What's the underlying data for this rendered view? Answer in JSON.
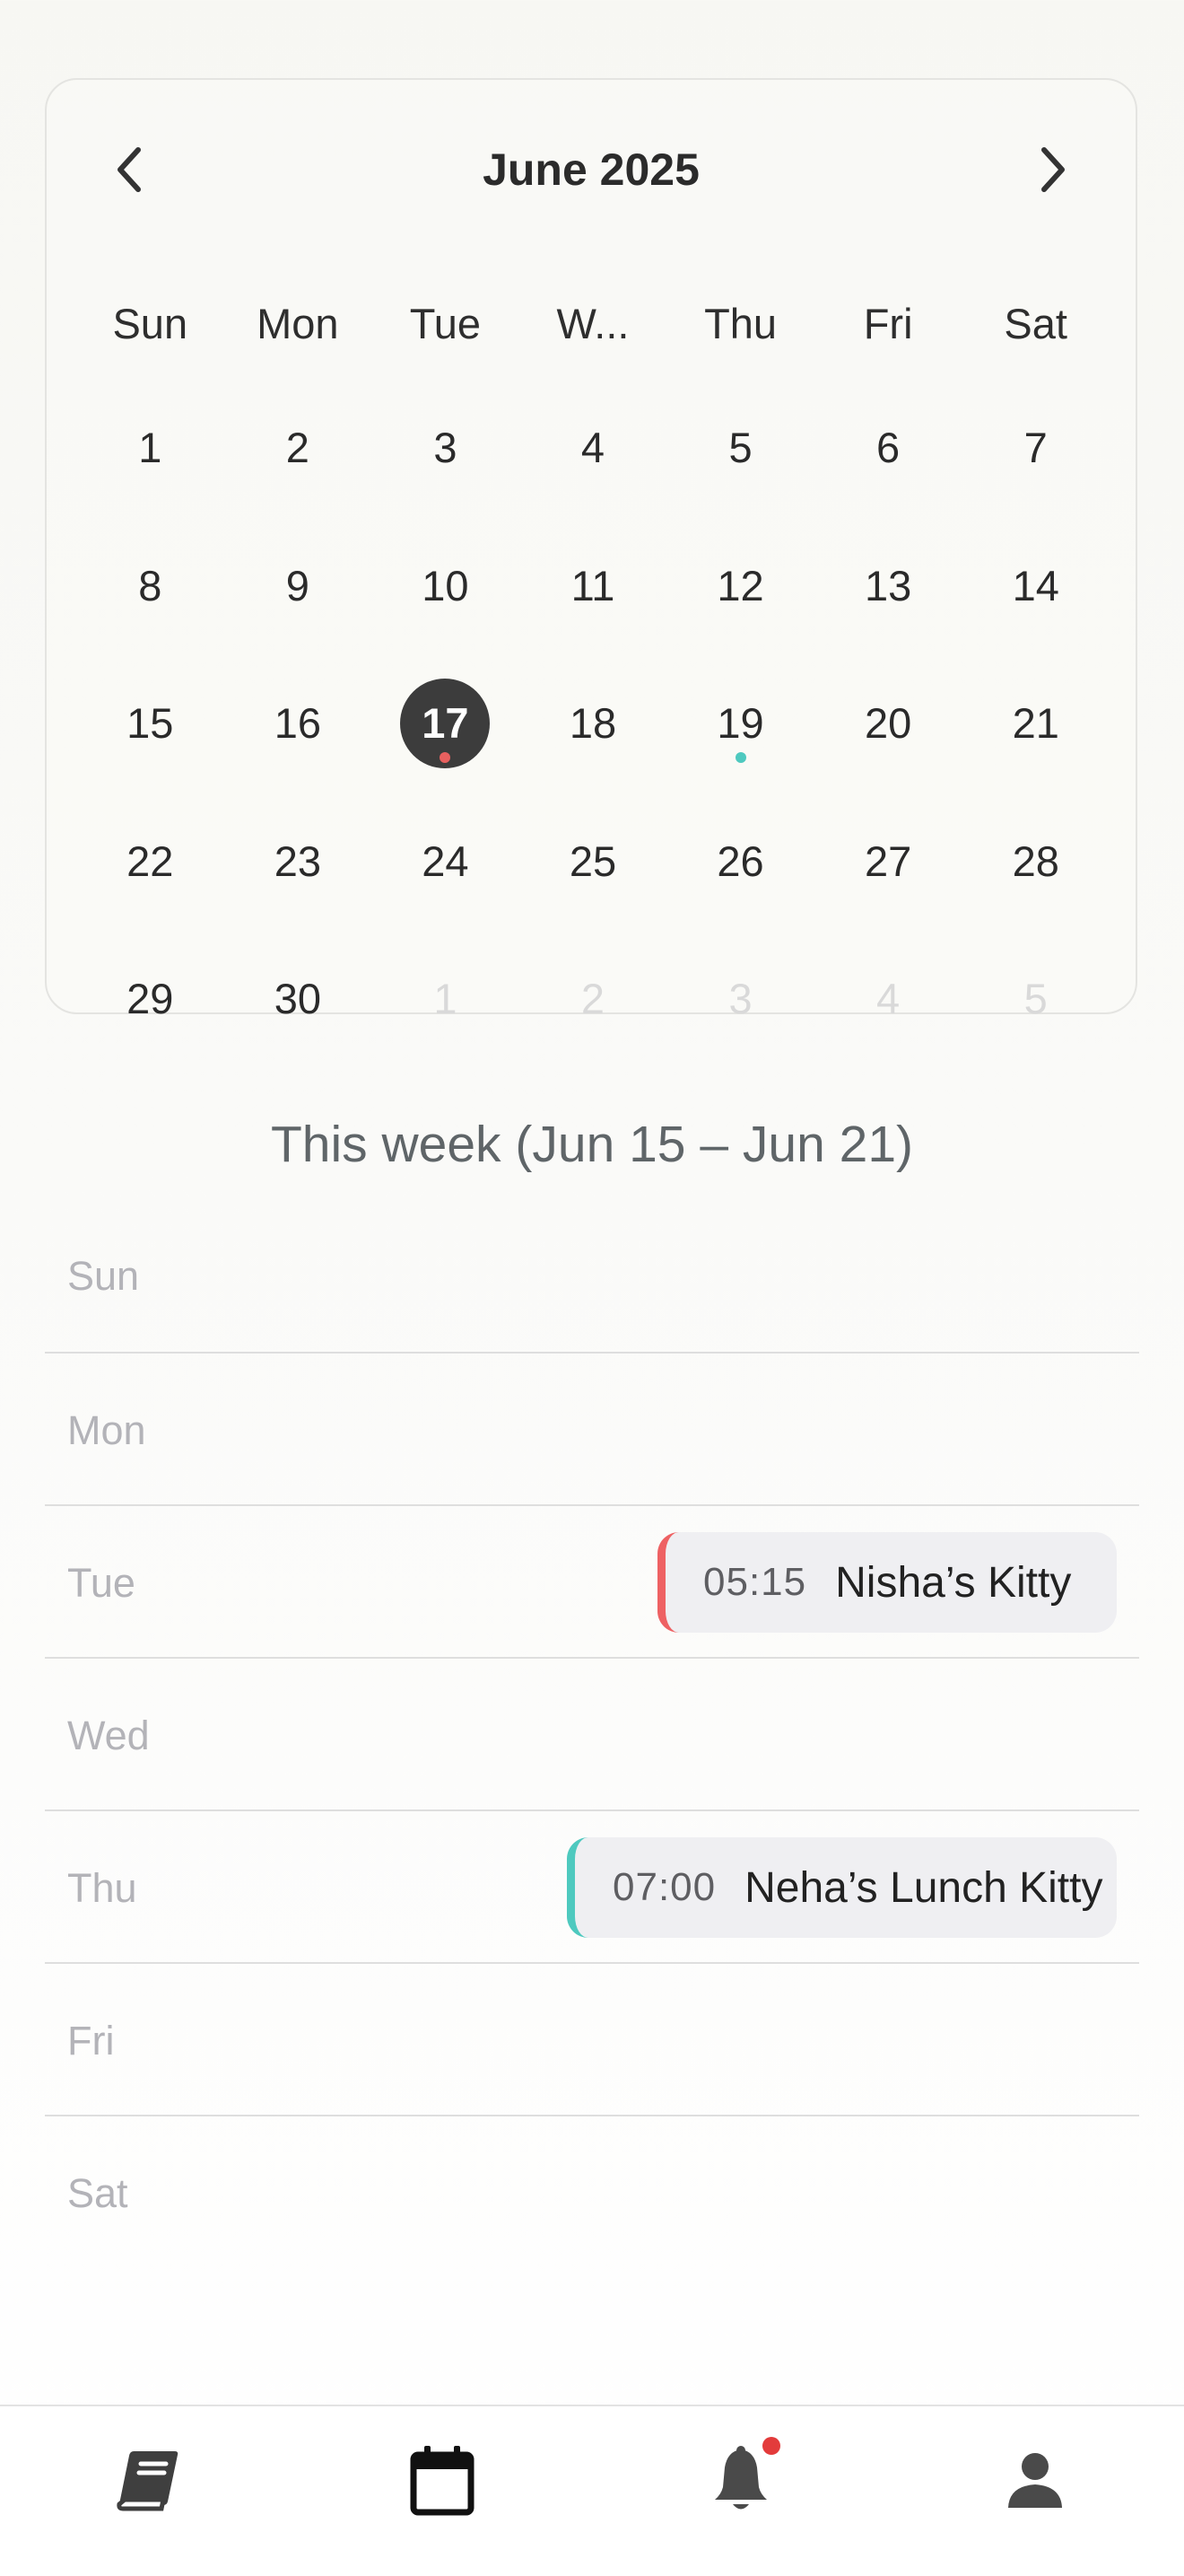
{
  "calendar": {
    "month_title": "June 2025",
    "weekdays": [
      "Sun",
      "Mon",
      "Tue",
      "W...",
      "Thu",
      "Fri",
      "Sat"
    ],
    "days": [
      {
        "label": "1"
      },
      {
        "label": "2"
      },
      {
        "label": "3"
      },
      {
        "label": "4"
      },
      {
        "label": "5"
      },
      {
        "label": "6"
      },
      {
        "label": "7"
      },
      {
        "label": "8"
      },
      {
        "label": "9"
      },
      {
        "label": "10"
      },
      {
        "label": "11"
      },
      {
        "label": "12"
      },
      {
        "label": "13"
      },
      {
        "label": "14"
      },
      {
        "label": "15"
      },
      {
        "label": "16"
      },
      {
        "label": "17",
        "selected": true,
        "dot": "#e8605f"
      },
      {
        "label": "18"
      },
      {
        "label": "19",
        "dot": "#4ec9bf"
      },
      {
        "label": "20"
      },
      {
        "label": "21"
      },
      {
        "label": "22"
      },
      {
        "label": "23"
      },
      {
        "label": "24"
      },
      {
        "label": "25"
      },
      {
        "label": "26"
      },
      {
        "label": "27"
      },
      {
        "label": "28"
      },
      {
        "label": "29"
      },
      {
        "label": "30"
      },
      {
        "label": "1",
        "muted": true
      },
      {
        "label": "2",
        "muted": true
      },
      {
        "label": "3",
        "muted": true
      },
      {
        "label": "4",
        "muted": true
      },
      {
        "label": "5",
        "muted": true
      }
    ],
    "prev_icon": "chevron-left-icon",
    "next_icon": "chevron-right-icon"
  },
  "week": {
    "title": "This week (Jun 15 – Jun 21)",
    "days": [
      {
        "label": "Sun"
      },
      {
        "label": "Mon"
      },
      {
        "label": "Tue",
        "event": {
          "time": "05:15",
          "title": "Nisha’s Kitty",
          "color": "#ee6163"
        }
      },
      {
        "label": "Wed"
      },
      {
        "label": "Thu",
        "event": {
          "time": "07:00",
          "title": "Neha’s Lunch Kitty",
          "color": "#4ec9bf"
        }
      },
      {
        "label": "Fri"
      },
      {
        "label": "Sat"
      }
    ]
  },
  "tabbar": {
    "items": [
      {
        "icon": "book-icon"
      },
      {
        "icon": "calendar-icon",
        "active": true
      },
      {
        "icon": "bell-icon",
        "badge_color": "#e33b3b"
      },
      {
        "icon": "person-icon"
      }
    ]
  }
}
